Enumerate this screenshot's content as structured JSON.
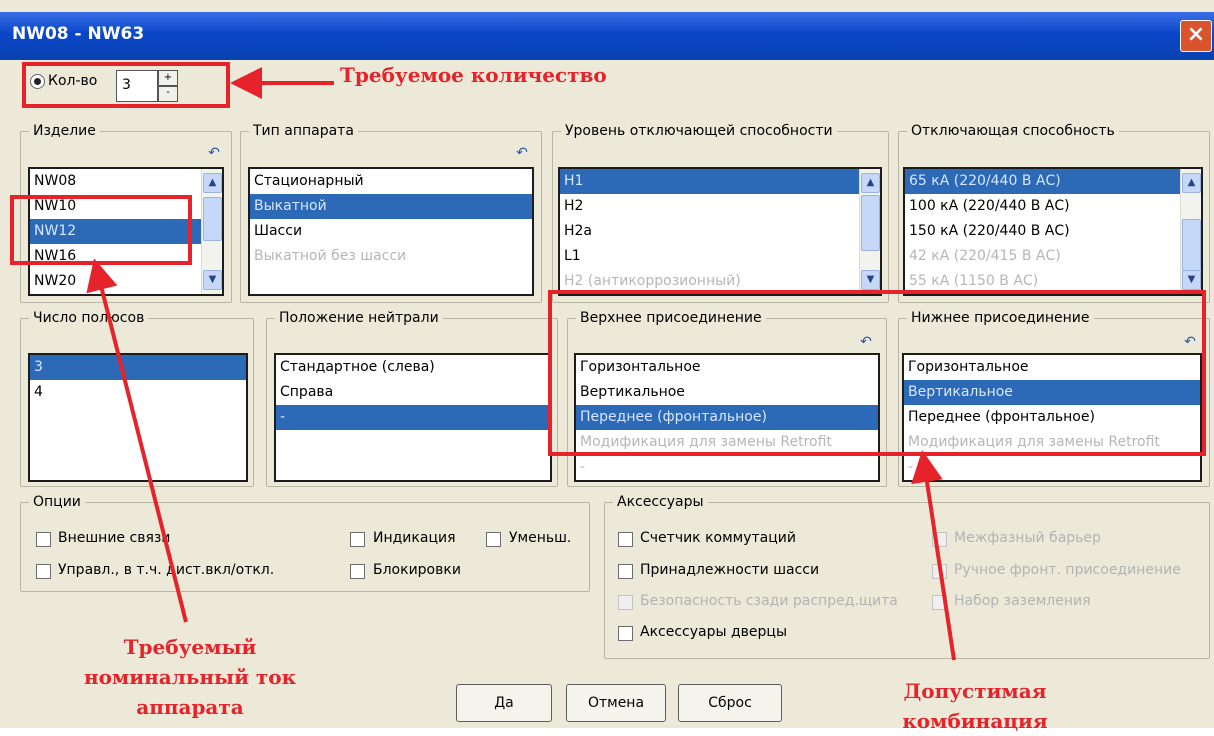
{
  "window": {
    "title": "NW08 - NW63",
    "close_glyph": "×"
  },
  "quantity": {
    "label": "Кол-во",
    "value": "3"
  },
  "groups": {
    "izdelie": {
      "legend": "Изделие",
      "items": [
        "NW08",
        "NW10",
        "NW12",
        "NW16",
        "NW20"
      ]
    },
    "tip": {
      "legend": "Тип аппарата",
      "items": [
        "Стационарный",
        "Выкатной",
        "Шасси",
        "Выкатной без шасси"
      ]
    },
    "uroven": {
      "legend": "Уровень отключающей способности",
      "items": [
        "H1",
        "H2",
        "H2a",
        "L1",
        "H2 (антикоррозионный)"
      ]
    },
    "otkl": {
      "legend": "Отключающая способность",
      "items": [
        "65 кА (220/440 В АС)",
        "100 кА (220/440 В АС)",
        "150 кА (220/440 В АС)",
        "42 кА  (220/415 В АС)",
        "55 кА (1150 В АС)"
      ]
    },
    "polus": {
      "legend": "Число полюсов",
      "items": [
        "3",
        "4"
      ]
    },
    "neutral": {
      "legend": "Положение нейтрали",
      "items": [
        "Стандартное  (слева)",
        "Справа",
        "-"
      ]
    },
    "verh": {
      "legend": "Верхнее присоединение",
      "items": [
        "Горизонтальное",
        "Вертикальное",
        "Переднее (фронтальное)",
        "Модификация для замены Retrofit",
        "-"
      ]
    },
    "niz": {
      "legend": "Нижнее присоединение",
      "items": [
        "Горизонтальное",
        "Вертикальное",
        "Переднее (фронтальное)",
        "Модификация для замены Retrofit",
        "-"
      ]
    }
  },
  "options": {
    "legend": "Опции",
    "items": [
      "Внешние связи",
      "Управл., в т.ч. дист.вкл/откл.",
      "Индикация",
      "Блокировки",
      "Уменьш."
    ]
  },
  "accessories": {
    "legend": "Аксессуары",
    "items": [
      "Счетчик коммутаций",
      "Принадлежности шасси",
      "Безопасность сзади распред.щита",
      "Аксессуары дверцы",
      "Межфазный барьер",
      "Ручное фронт. присоединение",
      "Набор заземления"
    ]
  },
  "buttons": {
    "ok": "Да",
    "cancel": "Отмена",
    "reset": "Сброс"
  },
  "annotations": {
    "qty": "Требуемое количество",
    "current": [
      "Требуемый",
      "номинальный ток",
      "аппарата"
    ],
    "combo": [
      "Допустимая",
      "комбинация"
    ]
  },
  "colors": {
    "accent_red": "#e6232a",
    "selection": "#2c6ab7",
    "titlebar": "#0a46c8"
  }
}
